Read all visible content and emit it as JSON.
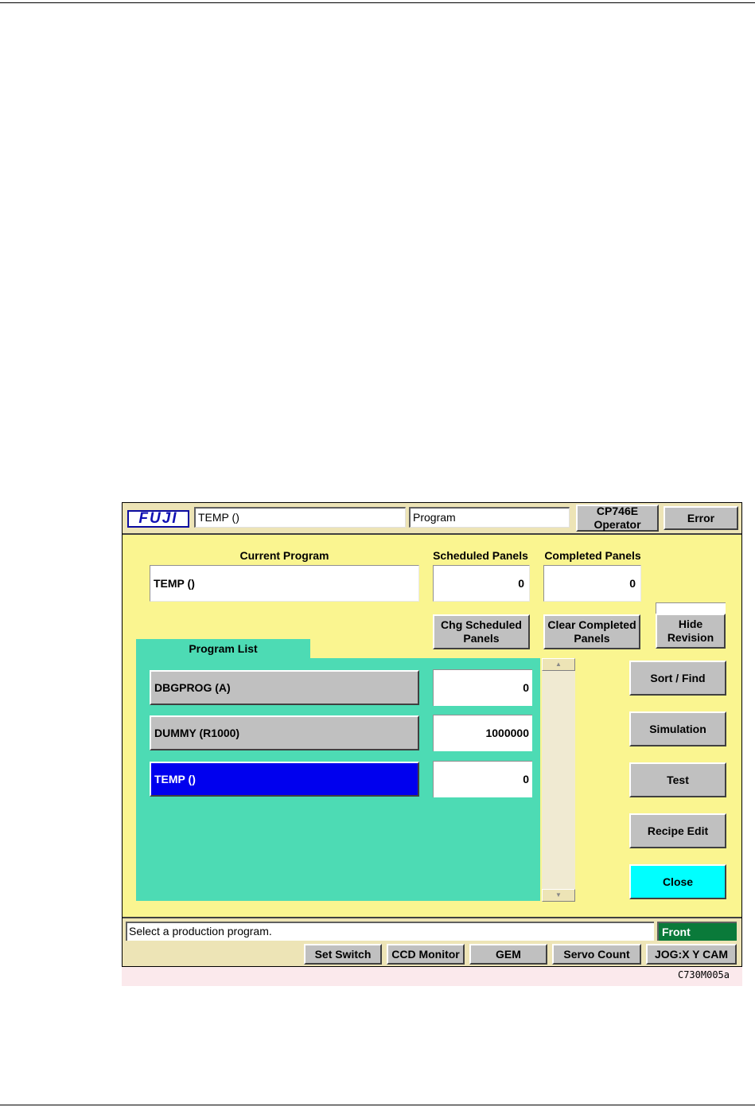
{
  "titlebar": {
    "logo": "FUJI",
    "program_field": "TEMP ()",
    "mode_field": "Program",
    "machine_button": "CP746E Operator",
    "error_button": "Error"
  },
  "current_program": {
    "label": "Current Program",
    "value": "TEMP ()"
  },
  "scheduled_panels": {
    "label": "Scheduled Panels",
    "value": "0",
    "button": "Chg Scheduled Panels"
  },
  "completed_panels": {
    "label": "Completed Panels",
    "value": "0",
    "button": "Clear Completed Panels"
  },
  "hide_revision_button": "Hide Revision",
  "program_list": {
    "title": "Program List",
    "rows": [
      {
        "name": "DBGPROG  (A)",
        "value": "0",
        "selected": false
      },
      {
        "name": "DUMMY  (R1000)",
        "value": "1000000",
        "selected": false
      },
      {
        "name": "TEMP  ()",
        "value": "0",
        "selected": true
      }
    ]
  },
  "side_buttons": {
    "sort_find": "Sort / Find",
    "simulation": "Simulation",
    "test": "Test",
    "recipe_edit": "Recipe Edit",
    "close": "Close"
  },
  "status": {
    "message": "Select a production program.",
    "side": "Front"
  },
  "bottom_buttons": {
    "set_switch": "Set Switch",
    "ccd_monitor": "CCD Monitor",
    "gem": "GEM",
    "servo_count": "Servo Count",
    "jog": "JOG:X Y CAM"
  },
  "caption": "C730M005a",
  "colors": {
    "screen_bg": "#faf590",
    "list_bg": "#4ddbb4",
    "selected_row": "#0000ee",
    "close_button": "#00ffff",
    "front_indicator": "#0a7a3a"
  }
}
